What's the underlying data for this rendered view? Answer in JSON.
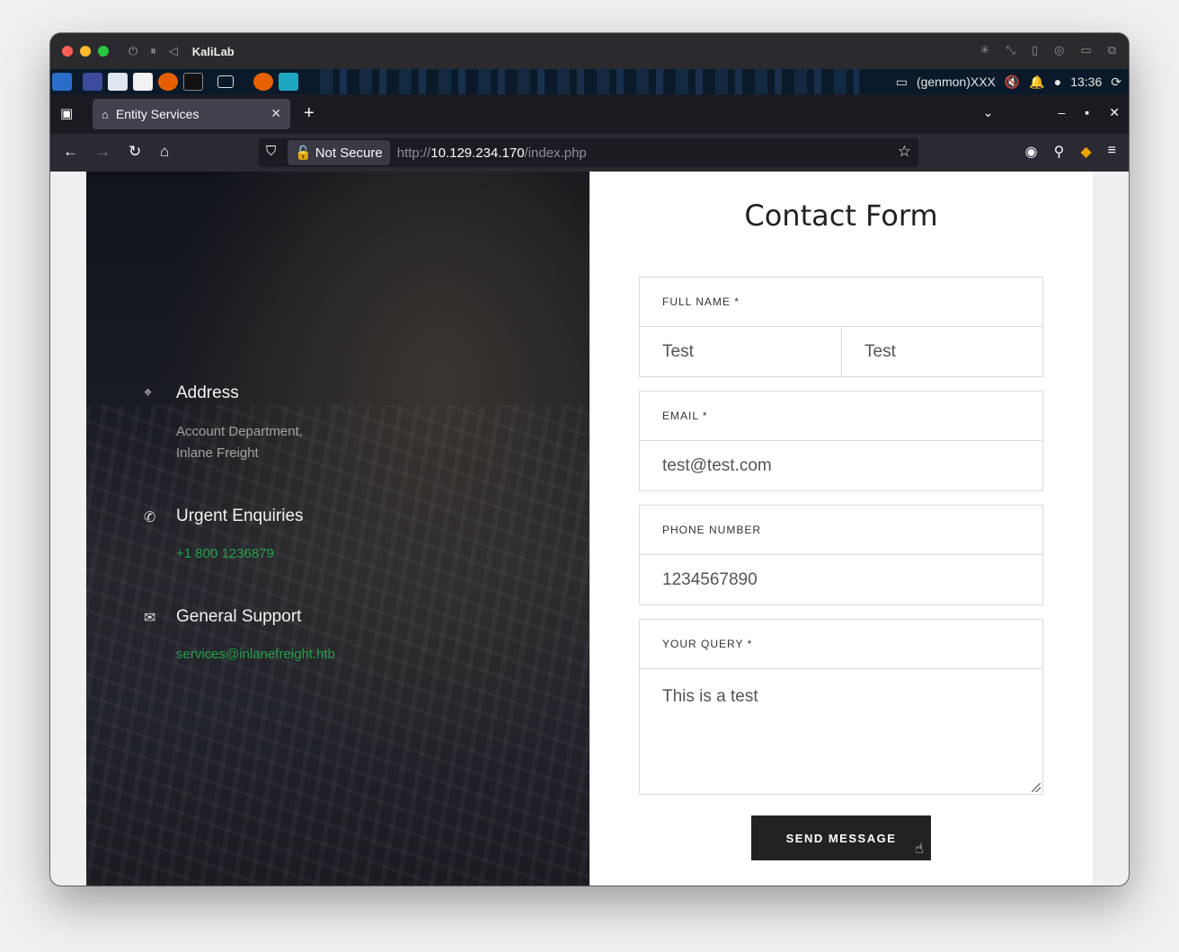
{
  "vm": {
    "title": "KaliLab",
    "traffic_colors": [
      "#ff5f57",
      "#febc2e",
      "#28c840"
    ]
  },
  "panel": {
    "genmon": "(genmon)XXX",
    "clock": "13:36"
  },
  "browser": {
    "tab_title": "Entity Services",
    "not_secure_label": "Not Secure",
    "url_scheme": "http://",
    "url_host": "10.129.234.170",
    "url_path": "/index.php"
  },
  "contact_info": {
    "address": {
      "title": "Address",
      "line1": "Account Department,",
      "line2": "Inlane Freight",
      "icon": "location-pin-icon"
    },
    "urgent": {
      "title": "Urgent Enquiries",
      "phone": "+1 800 1236879",
      "icon": "phone-icon"
    },
    "support": {
      "title": "General Support",
      "email": "services@inlanefreight.htb",
      "icon": "envelope-icon"
    },
    "link_color": "#24a148"
  },
  "form": {
    "title": "Contact Form",
    "full_name_label": "FULL NAME *",
    "first_name": "Test",
    "last_name": "Test",
    "email_label": "EMAIL *",
    "email": "test@test.com",
    "phone_label": "PHONE NUMBER",
    "phone": "1234567890",
    "query_label": "YOUR QUERY *",
    "query": "This is a test",
    "submit_label": "SEND MESSAGE"
  }
}
